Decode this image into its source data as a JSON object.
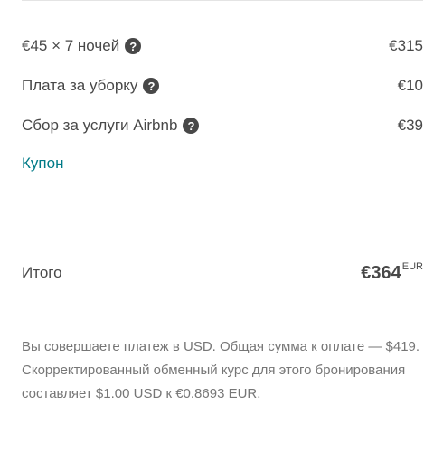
{
  "price_rows": [
    {
      "label": "€45 × 7 ночей",
      "amount": "€315"
    },
    {
      "label": "Плата за уборку",
      "amount": "€10"
    },
    {
      "label": "Сбор за услуги Airbnb",
      "amount": "€39"
    }
  ],
  "coupon_label": "Купон",
  "total": {
    "label": "Итого",
    "amount": "€364",
    "currency": "EUR"
  },
  "note": "Вы совершаете платеж в USD. Общая сумма к оплате — $419. Скорректированный обменный курс для этого бронирования составляет $1.00 USD к €0.8693 EUR.",
  "colors": {
    "text": "#484848",
    "link": "#007a87",
    "muted": "#767676",
    "divider": "#e4e4e4"
  },
  "icons": {
    "help": "question-circle-icon"
  }
}
